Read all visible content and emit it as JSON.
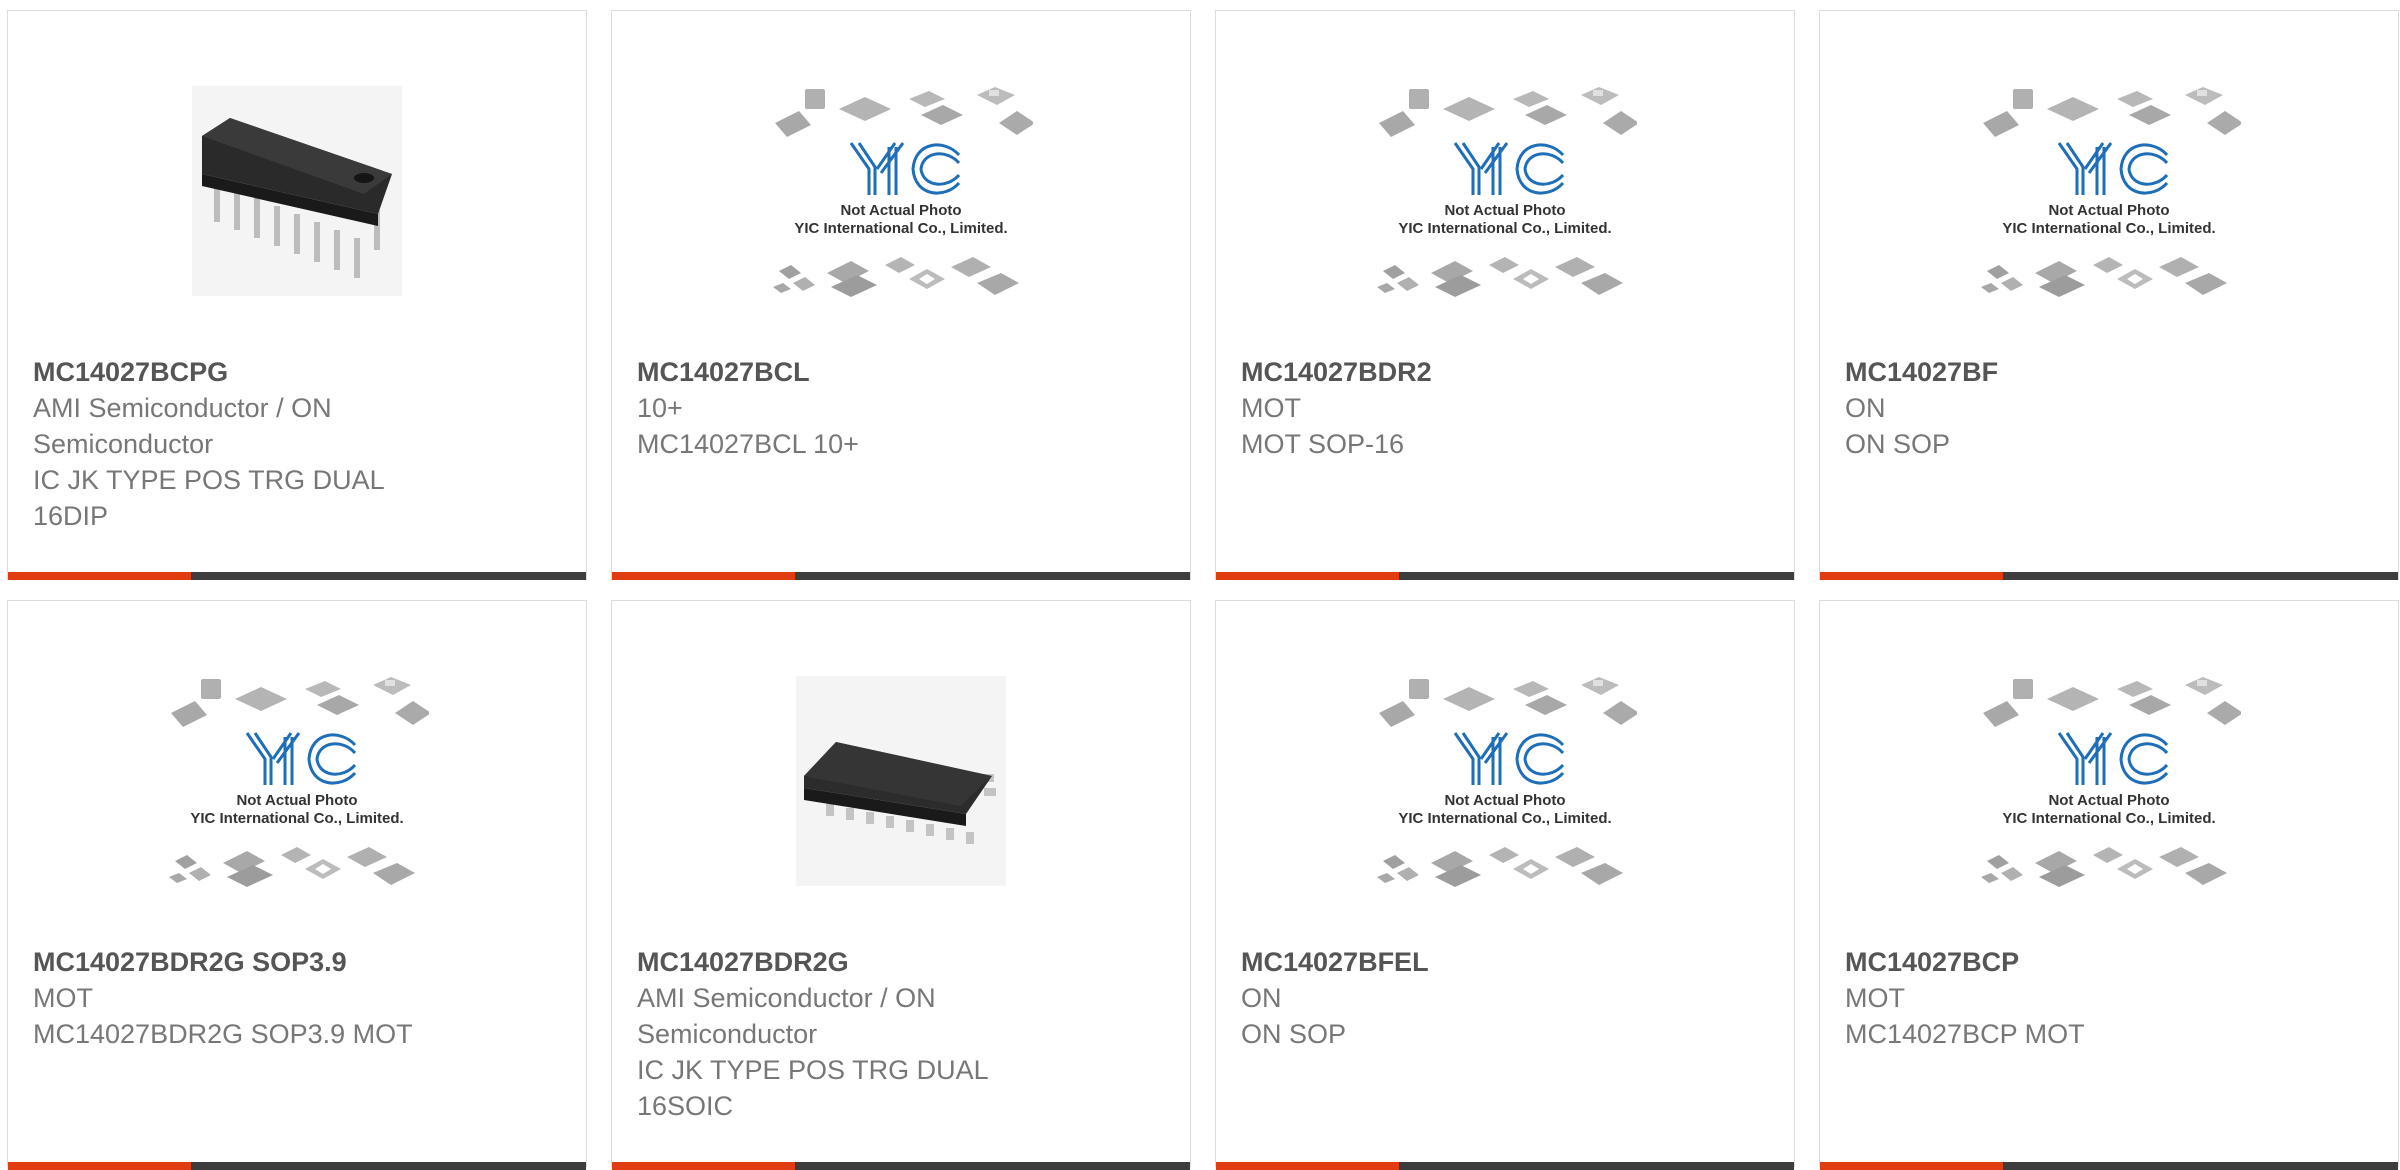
{
  "placeholder_image": {
    "caption_1": "Not Actual Photo",
    "caption_2": "YIC International Co., Limited."
  },
  "colors": {
    "accent": "#e23d12",
    "bar": "#3d3d3d",
    "logo_blue": "#1e6eb8"
  },
  "products": [
    {
      "part": "MC14027BCPG",
      "lines": [
        "AMI Semiconductor / ON",
        "Semiconductor",
        "IC JK TYPE POS TRG DUAL",
        "16DIP"
      ],
      "image": "dip-package-photo"
    },
    {
      "part": "MC14027BCL",
      "lines": [
        "10+",
        "MC14027BCL 10+"
      ],
      "image": "yic-placeholder"
    },
    {
      "part": "MC14027BDR2",
      "lines": [
        "MOT",
        "MOT SOP-16"
      ],
      "image": "yic-placeholder"
    },
    {
      "part": "MC14027BF",
      "lines": [
        "ON",
        "ON SOP"
      ],
      "image": "yic-placeholder"
    },
    {
      "part": "MC14027BDR2G SOP3.9",
      "lines": [
        "MOT",
        "MC14027BDR2G SOP3.9 MOT"
      ],
      "image": "yic-placeholder"
    },
    {
      "part": "MC14027BDR2G",
      "lines": [
        "AMI Semiconductor / ON",
        "Semiconductor",
        "IC JK TYPE POS TRG DUAL",
        "16SOIC"
      ],
      "image": "soic-package-photo"
    },
    {
      "part": "MC14027BFEL",
      "lines": [
        "ON",
        "ON SOP"
      ],
      "image": "yic-placeholder"
    },
    {
      "part": "MC14027BCP",
      "lines": [
        "MOT",
        "MC14027BCP MOT"
      ],
      "image": "yic-placeholder"
    }
  ]
}
